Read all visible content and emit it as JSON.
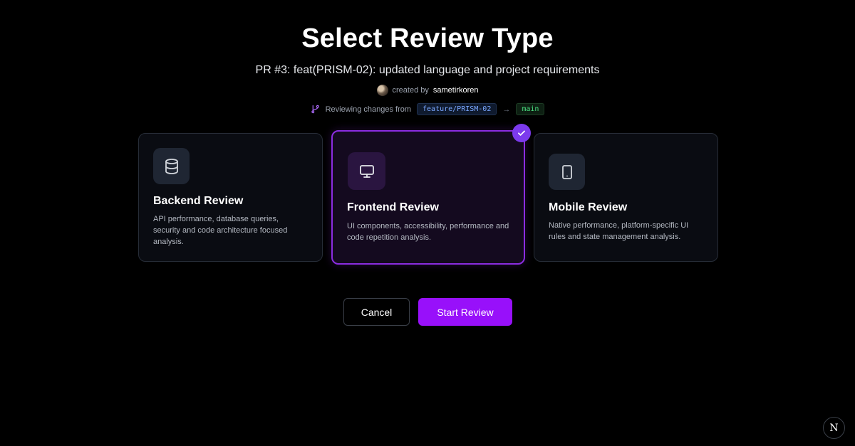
{
  "header": {
    "title": "Select Review Type",
    "subtitle": "PR #3: feat(PRISM-02): updated language and project requirements",
    "created_by_label": "created by",
    "author": "sametirkoren",
    "branch_label": "Reviewing changes from",
    "source_branch": "feature/PRISM-02",
    "arrow": "→",
    "target_branch": "main"
  },
  "cards": [
    {
      "id": "backend",
      "title": "Backend Review",
      "description": "API performance, database queries, security and code architecture focused analysis.",
      "icon": "database-icon",
      "selected": false
    },
    {
      "id": "frontend",
      "title": "Frontend Review",
      "description": "UI components, accessibility, performance and code repetition analysis.",
      "icon": "monitor-icon",
      "selected": true
    },
    {
      "id": "mobile",
      "title": "Mobile Review",
      "description": "Native performance, platform-specific UI rules and state management analysis.",
      "icon": "tablet-icon",
      "selected": false
    }
  ],
  "actions": {
    "cancel_label": "Cancel",
    "start_label": "Start Review"
  },
  "corner_badge": {
    "label": "N",
    "icon": "nextjs-logo-icon"
  },
  "colors": {
    "accent": "#9810fa",
    "selected_border": "#8b2ce0",
    "check_badge": "#7c3aed",
    "source_branch": "#7aa7ff",
    "target_branch": "#4ade80"
  }
}
